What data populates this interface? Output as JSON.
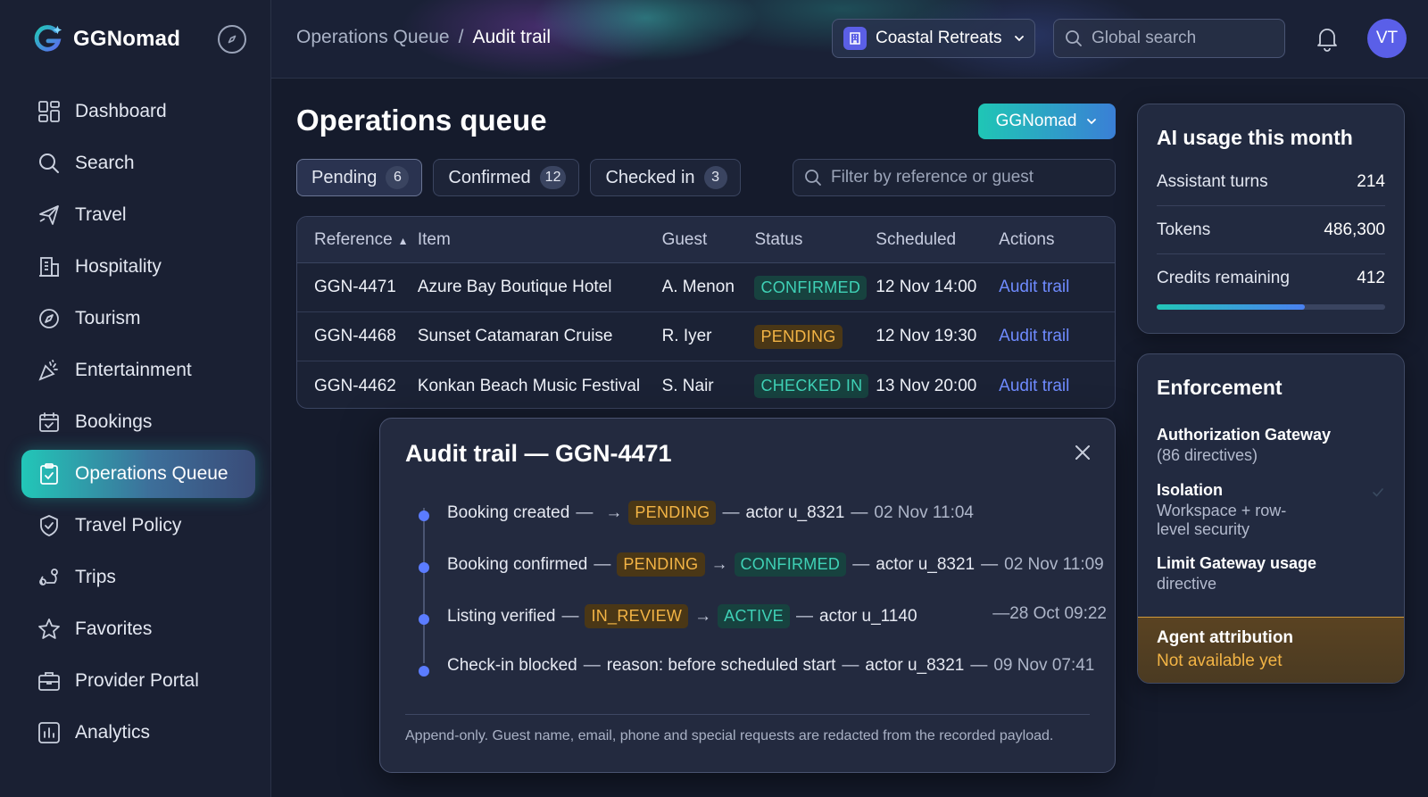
{
  "app": {
    "brand": "GGNomad"
  },
  "sidebar": {
    "items": [
      {
        "label": "Dashboard",
        "icon": "dashboard-icon"
      },
      {
        "label": "Search",
        "icon": "search-icon"
      },
      {
        "label": "Travel",
        "icon": "plane-icon"
      },
      {
        "label": "Hospitality",
        "icon": "building-icon"
      },
      {
        "label": "Tourism",
        "icon": "compass-icon"
      },
      {
        "label": "Entertainment",
        "icon": "party-icon"
      },
      {
        "label": "Bookings",
        "icon": "calendar-check-icon"
      },
      {
        "label": "Operations Queue",
        "icon": "clipboard-check-icon",
        "active": true
      },
      {
        "label": "Travel Policy",
        "icon": "shield-check-icon"
      },
      {
        "label": "Trips",
        "icon": "route-icon"
      },
      {
        "label": "Favorites",
        "icon": "star-icon"
      },
      {
        "label": "Provider Portal",
        "icon": "briefcase-icon"
      },
      {
        "label": "Analytics",
        "icon": "bar-chart-icon"
      }
    ]
  },
  "header": {
    "breadcrumb": {
      "parent": "Operations Queue",
      "separator": "/",
      "current": "Audit trail"
    },
    "workspace": "Coastal Retreats",
    "search_placeholder": "Global search",
    "avatar_initials": "VT"
  },
  "main": {
    "title": "Operations queue",
    "org_button": "GGNomad",
    "tabs": [
      {
        "label": "Pending",
        "count": "6",
        "active": true
      },
      {
        "label": "Confirmed",
        "count": "12"
      },
      {
        "label": "Checked in",
        "count": "3"
      }
    ],
    "filter_placeholder": "Filter by reference or guest",
    "table": {
      "columns": [
        "Reference",
        "Item",
        "Guest",
        "Status",
        "Scheduled",
        "Actions"
      ],
      "rows": [
        {
          "reference": "GGN-4471",
          "item": "Azure Bay Boutique Hotel",
          "guest": "A. Menon",
          "status": "CONFIRMED",
          "scheduled": "12 Nov 14:00",
          "action": "Audit trail"
        },
        {
          "reference": "GGN-4468",
          "item": "Sunset Catamaran Cruise",
          "guest": "R. Iyer",
          "status": "PENDING",
          "scheduled": "12 Nov 19:30",
          "action": "Audit trail"
        },
        {
          "reference": "GGN-4462",
          "item": "Konkan Beach Music Festival",
          "guest": "S. Nair",
          "status": "CHECKED IN",
          "scheduled": "13 Nov 20:00",
          "action": "Audit trail"
        }
      ]
    }
  },
  "modal": {
    "title": "Audit trail — GGN-4471",
    "events": [
      {
        "label": "Booking created",
        "from": "",
        "to": "PENDING",
        "actor": "actor u_8321",
        "when": "02 Nov 11:04"
      },
      {
        "label": "Booking confirmed",
        "from": "PENDING",
        "to": "CONFIRMED",
        "actor": "actor u_8321",
        "when": "02 Nov 11:09"
      },
      {
        "label": "Listing verified",
        "from": "IN_REVIEW",
        "to": "ACTIVE",
        "actor": "actor u_1140",
        "when": "28 Oct 09:22"
      },
      {
        "label": "Check-in blocked",
        "reason": "reason: before scheduled start",
        "actor": "actor u_8321",
        "when": "09 Nov 07:41"
      }
    ],
    "footer": "Append-only. Guest name, email, phone and special requests are redacted from the recorded payload."
  },
  "usage": {
    "title": "AI usage this month",
    "stats": [
      {
        "label": "Assistant turns",
        "value": "214"
      },
      {
        "label": "Tokens",
        "value": "486,300"
      },
      {
        "label": "Credits remaining",
        "value": "412"
      }
    ],
    "credits_progress_fraction": 0.65
  },
  "enforcement": {
    "title": "Enforcement",
    "items": [
      {
        "name": "Authorization Gateway",
        "desc": "(86 directives)"
      },
      {
        "name": "Isolation",
        "desc": "Workspace + row-level security"
      },
      {
        "name": "Limit Gateway usage",
        "desc": "directive"
      }
    ],
    "attribution": {
      "name": "Agent attribution",
      "value": "Not available yet"
    }
  },
  "colors": {
    "accent_teal": "#22c7b8",
    "accent_blue": "#5b7cff",
    "pending": "#f3b445",
    "confirmed": "#3fd1b6",
    "link": "#6f8bff"
  }
}
